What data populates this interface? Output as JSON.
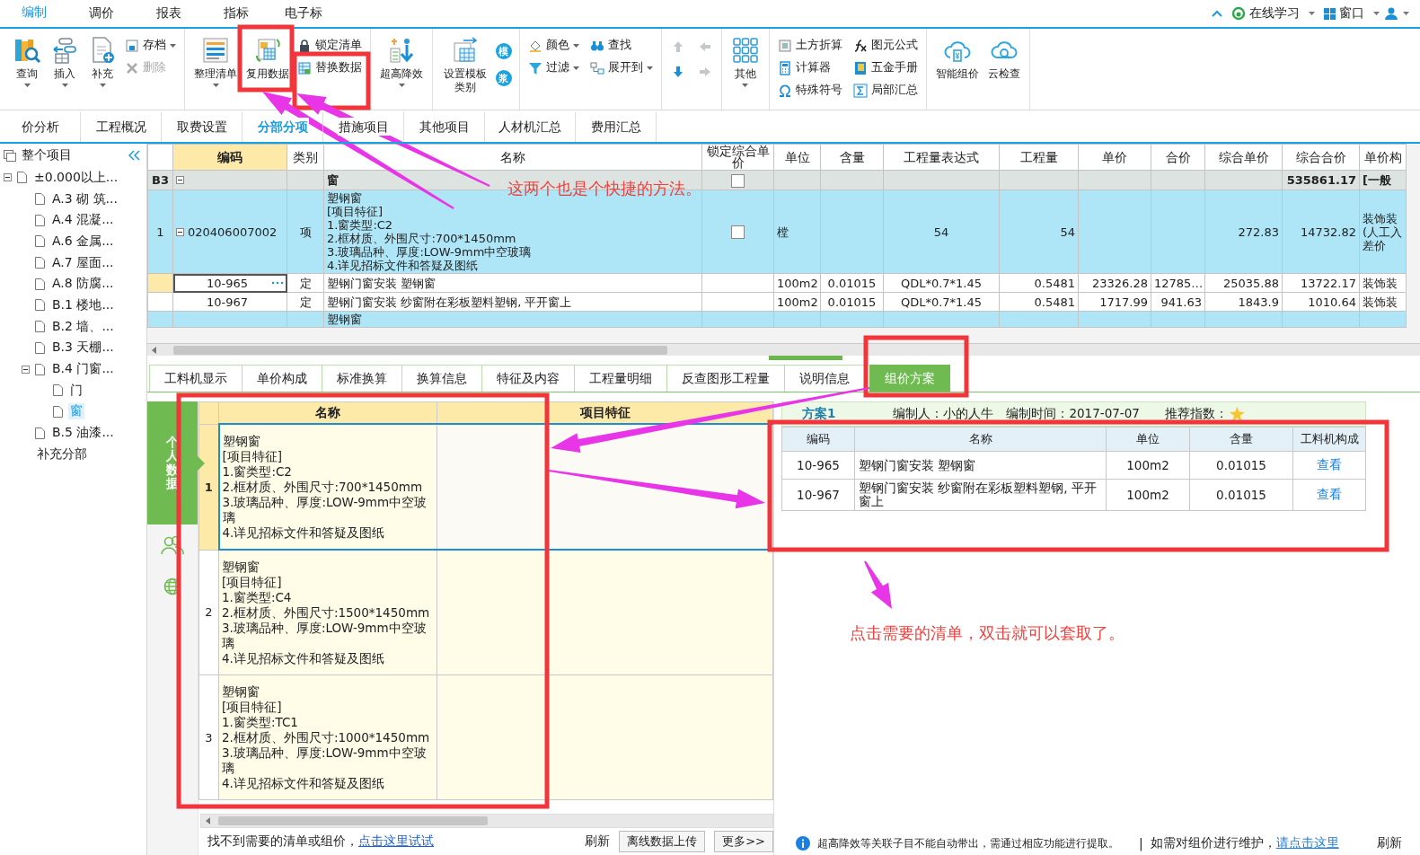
{
  "menu": {
    "tabs": [
      {
        "label": "编制",
        "selected": true
      },
      {
        "label": "调价",
        "selected": false
      },
      {
        "label": "报表",
        "selected": false
      },
      {
        "label": "指标",
        "selected": false
      },
      {
        "label": "电子标",
        "selected": false
      }
    ],
    "right": [
      {
        "label": "在线学习"
      },
      {
        "label": "窗口"
      }
    ]
  },
  "toolbar": [
    {
      "items": [
        {
          "kind": "large",
          "label": "查询",
          "dropdown": true
        },
        {
          "kind": "large",
          "label": "插入",
          "dropdown": true
        },
        {
          "kind": "large",
          "label": "补充",
          "dropdown": true
        },
        {
          "kind": "small",
          "label": "存档",
          "dropdown": true,
          "disabled": false
        },
        {
          "kind": "small",
          "label": "删除",
          "dropdown": false,
          "disabled": true
        }
      ]
    },
    {
      "items": [
        {
          "kind": "large",
          "label": "整理清单",
          "dropdown": true
        },
        {
          "kind": "large",
          "label": "复用数据",
          "dropdown": false
        },
        {
          "kind": "small",
          "label": "锁定清单",
          "dropdown": false,
          "disabled": false
        },
        {
          "kind": "small",
          "label": "替换数据",
          "dropdown": false,
          "disabled": false
        }
      ]
    },
    {
      "items": [
        {
          "kind": "large",
          "label": "超高降效",
          "dropdown": true
        }
      ]
    },
    {
      "items": [
        {
          "kind": "large",
          "label": "设置模板类别",
          "dropdown": false
        },
        {
          "kind": "glyph",
          "label": "模"
        },
        {
          "kind": "glyph",
          "label": "浆"
        }
      ]
    },
    {
      "items": [
        {
          "kind": "small",
          "label": "颜色",
          "dropdown": true,
          "disabled": false
        },
        {
          "kind": "small",
          "label": "查找",
          "dropdown": false,
          "disabled": false
        },
        {
          "kind": "small",
          "label": "过滤",
          "dropdown": true,
          "disabled": false
        },
        {
          "kind": "small",
          "label": "展开到",
          "dropdown": true,
          "disabled": false
        }
      ]
    },
    {
      "items": [
        {
          "kind": "arrow",
          "disabled": true
        },
        {
          "kind": "arrow",
          "disabled": true
        },
        {
          "kind": "arrow",
          "disabled": false
        },
        {
          "kind": "arrow",
          "disabled": true
        }
      ]
    },
    {
      "items": [
        {
          "kind": "large",
          "label": "其他",
          "dropdown": true
        }
      ]
    },
    {
      "items": [
        {
          "kind": "small",
          "label": "土方折算",
          "dropdown": false,
          "disabled": false
        },
        {
          "kind": "small",
          "label": "图元公式",
          "dropdown": false,
          "disabled": false
        },
        {
          "kind": "small",
          "label": "计算器",
          "dropdown": false,
          "disabled": false
        },
        {
          "kind": "small",
          "label": "五金手册",
          "dropdown": false,
          "disabled": false
        },
        {
          "kind": "small",
          "label": "特殊符号",
          "dropdown": false,
          "disabled": false
        },
        {
          "kind": "small",
          "label": "局部汇总",
          "dropdown": false,
          "disabled": false
        }
      ]
    },
    {
      "items": [
        {
          "kind": "large",
          "label": "智能组价",
          "dropdown": false
        },
        {
          "kind": "large",
          "label": "云检查",
          "dropdown": false
        }
      ]
    }
  ],
  "module_tabs": [
    {
      "label": "价分析",
      "selected": false
    },
    {
      "label": "工程概况",
      "selected": false
    },
    {
      "label": "取费设置",
      "selected": false
    },
    {
      "label": "分部分项",
      "selected": true
    },
    {
      "label": "措施项目",
      "selected": false
    },
    {
      "label": "其他项目",
      "selected": false
    },
    {
      "label": "人材机汇总",
      "selected": false
    },
    {
      "label": "费用汇总",
      "selected": false
    }
  ],
  "tree": {
    "title": "整个项目",
    "items": [
      {
        "label": "±0.000以上...",
        "kind": "doc",
        "selected": false,
        "expanded": true,
        "children": [
          {
            "label": "A.3 砌 筑...",
            "kind": "doc",
            "selected": false
          },
          {
            "label": "A.4 混凝...",
            "kind": "doc",
            "selected": false
          },
          {
            "label": "A.6 金属...",
            "kind": "doc",
            "selected": false
          },
          {
            "label": "A.7 屋面...",
            "kind": "doc",
            "selected": false
          },
          {
            "label": "A.8 防腐...",
            "kind": "doc",
            "selected": false
          },
          {
            "label": "B.1 楼地...",
            "kind": "doc",
            "selected": false
          },
          {
            "label": "B.2 墙、...",
            "kind": "doc",
            "selected": false
          },
          {
            "label": "B.3 天棚...",
            "kind": "doc",
            "selected": false
          },
          {
            "label": "B.4 门窗...",
            "kind": "doc",
            "selected": false,
            "expanded": true,
            "children": [
              {
                "label": "门",
                "kind": "doc",
                "selected": false
              },
              {
                "label": "窗",
                "kind": "doc",
                "selected": true
              }
            ]
          },
          {
            "label": "B.5 油漆...",
            "kind": "doc",
            "selected": false
          },
          {
            "label": "补充分部",
            "kind": "plain",
            "selected": false
          }
        ]
      }
    ]
  },
  "grid": {
    "columns": [
      "编码",
      "类别",
      "名称",
      "锁定综合单价",
      "单位",
      "含量",
      "工程量表达式",
      "工程量",
      "单价",
      "合价",
      "综合单价",
      "综合合价",
      "单价构"
    ],
    "rows": [
      {
        "kind": "group",
        "num": "B3",
        "expanded": true,
        "locked": false,
        "selected": false,
        "cells": [
          null,
          null,
          "窗",
          null,
          null,
          null,
          null,
          null,
          null,
          null,
          null,
          "535861.17",
          "[一般"
        ]
      },
      {
        "kind": "item",
        "num": "1",
        "expanded": true,
        "locked": false,
        "selected": false,
        "cells": [
          "020406007002",
          "项",
          "塑钢窗\n[项目特征]\n1.窗类型:C2\n2.框材质、外围尺寸:700*1450mm\n3.玻璃品种、厚度:LOW-9mm中空玻璃\n4.详见招标文件和答疑及图纸",
          null,
          "樘",
          null,
          "54",
          "54",
          null,
          null,
          "272.83",
          "14732.82",
          "装饰装(人工入差价"
        ]
      },
      {
        "kind": "sub",
        "selected": true,
        "cells": [
          "10-965",
          "定",
          "塑钢门窗安装 塑钢窗",
          null,
          "100m2",
          "0.01015",
          "QDL*0.7*1.45",
          "0.5481",
          "23326.28",
          "12785…",
          "25035.88",
          "13722.17",
          "装饰装"
        ]
      },
      {
        "kind": "sub",
        "selected": false,
        "cells": [
          "10-967",
          "定",
          "塑钢门窗安装 纱窗附在彩板塑料塑钢, 平开窗上",
          null,
          "100m2",
          "0.01015",
          "QDL*0.7*1.45",
          "0.5481",
          "1717.99",
          "941.63",
          "1843.9",
          "1010.64",
          "装饰装"
        ]
      },
      {
        "kind": "item",
        "selected": false,
        "cells": [
          null,
          null,
          "塑钢窗",
          null,
          null,
          null,
          null,
          null,
          null,
          null,
          null,
          null,
          null
        ]
      }
    ]
  },
  "detail_tabs": [
    {
      "label": "工料机显示",
      "selected": false
    },
    {
      "label": "单价构成",
      "selected": false
    },
    {
      "label": "标准换算",
      "selected": false
    },
    {
      "label": "换算信息",
      "selected": false
    },
    {
      "label": "特征及内容",
      "selected": false
    },
    {
      "label": "工程量明细",
      "selected": false
    },
    {
      "label": "反查图形工程量",
      "selected": false
    },
    {
      "label": "说明信息",
      "selected": false
    },
    {
      "label": "组价方案",
      "selected": true
    }
  ],
  "side_tabs": [
    {
      "kind": "text",
      "label": "个人数据",
      "selected": true
    },
    {
      "kind": "people",
      "selected": false
    },
    {
      "kind": "globe",
      "selected": false
    }
  ],
  "bill_list": {
    "columns": [
      "名称",
      "项目特征"
    ],
    "rows": [
      {
        "num": "1",
        "selected": true,
        "name": "塑钢窗\n[项目特征]\n1.窗类型:C2\n2.框材质、外围尺寸:700*1450mm\n3.玻璃品种、厚度:LOW-9mm中空玻璃\n4.详见招标文件和答疑及图纸"
      },
      {
        "num": "2",
        "selected": false,
        "name": "塑钢窗\n[项目特征]\n1.窗类型:C4\n2.框材质、外围尺寸:1500*1450mm\n3.玻璃品种、厚度:LOW-9mm中空玻璃\n4.详见招标文件和答疑及图纸"
      },
      {
        "num": "3",
        "selected": false,
        "name": "塑钢窗\n[项目特征]\n1.窗类型:TC1\n2.框材质、外围尺寸:1000*1450mm\n3.玻璃品种、厚度:LOW-9mm中空玻璃\n4.详见招标文件和答疑及图纸"
      }
    ],
    "footer": {
      "text": "找不到需要的清单或组价，",
      "link": "点击这里试试",
      "refresh": "刷新",
      "upload": "离线数据上传",
      "more": "更多>>"
    }
  },
  "scheme": {
    "title": "方案1",
    "author": "编制人：小的人牛",
    "time": "编制时间：2017-07-07",
    "rating_label": "推荐指数：",
    "columns": [
      "编码",
      "名称",
      "单位",
      "含量",
      "工料机构成"
    ],
    "rows": [
      {
        "cells": [
          "10-965",
          "塑钢门窗安装 塑钢窗",
          "100m2",
          "0.01015"
        ],
        "link": "查看"
      },
      {
        "cells": [
          "10-967",
          "塑钢门窗安装 纱窗附在彩板塑料塑钢, 平开窗上",
          "100m2",
          "0.01015"
        ],
        "link": "查看"
      }
    ],
    "status": {
      "notice": "超高降效等关联子目不能自动带出，需通过相应功能进行提取。",
      "separator": "|",
      "text": "如需对组价进行维护，",
      "link": "请点击这里",
      "refresh": "刷新"
    }
  },
  "annotations": [
    "这两个也是个快捷的方法。",
    "点击需要的清单，双击就可以套取了。"
  ]
}
